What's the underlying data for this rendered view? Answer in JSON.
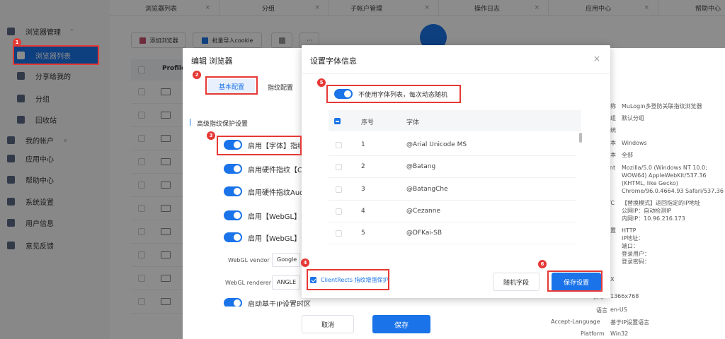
{
  "sidebar": {
    "items": [
      {
        "label": "浏览器管理"
      },
      {
        "label": "浏览器列表"
      },
      {
        "label": "分享给我的"
      },
      {
        "label": "分组"
      },
      {
        "label": "回收站"
      },
      {
        "label": "我的帐户"
      },
      {
        "label": "应用中心"
      },
      {
        "label": "帮助中心"
      },
      {
        "label": "系统设置"
      },
      {
        "label": "用户信息"
      },
      {
        "label": "意见反馈"
      }
    ]
  },
  "tabs": [
    {
      "label": "浏览器列表"
    },
    {
      "label": "分组"
    },
    {
      "label": "子帐户管理"
    },
    {
      "label": "操作日志"
    },
    {
      "label": "应用中心"
    },
    {
      "label": "帮助中心"
    }
  ],
  "toolbar": {
    "add_browser": "添加浏览器",
    "batch_import": "批量导入cookie",
    "more": "···",
    "col_profile": "Profilel"
  },
  "edit_panel": {
    "title": "编辑 浏览器",
    "tab_basic": "基本配置",
    "tab_fingerprint": "指纹配置",
    "section": "高级指纹保护设置",
    "switches": [
      "启用【字体】指纹",
      "启用硬件指纹【Ca",
      "启用硬件指纹Aud",
      "启用【WebGL】图",
      "启用【WebGL】元",
      "启动基于IP设置时区"
    ],
    "webgl_vendor_label": "WebGL vendor",
    "webgl_vendor_value": "Google",
    "webgl_renderer_label": "WebGL renderer",
    "webgl_renderer_value": "ANGLE",
    "cancel": "取消",
    "save": "保存"
  },
  "info": {
    "lines": [
      {
        "k": "称",
        "v": "MuLogin多登防关联指纹浏览器"
      },
      {
        "k": "组",
        "v": "默认分组"
      },
      {
        "k": "",
        "v": "统"
      },
      {
        "k": "本",
        "v": "Windows"
      },
      {
        "k": "本",
        "v": "全部"
      },
      {
        "k": "ent",
        "v": "Mozilla/5.0 (Windows NT 10.0;"
      },
      {
        "k": "",
        "v": "WOW64) AppleWebKit/537.36"
      },
      {
        "k": "",
        "v": "(KHTML, like Gecko)"
      },
      {
        "k": "",
        "v": "Chrome/96.0.4664.93 Safari/537.36"
      },
      {
        "k": "TC",
        "v": "【替换模式】返回指定的IP地址"
      },
      {
        "k": "",
        "v": "公网IP：自动检测IP"
      },
      {
        "k": "",
        "v": "内网IP：10.96.216.173"
      },
      {
        "k": "置",
        "v": "HTTP"
      },
      {
        "k": "",
        "v": "IP地址："
      },
      {
        "k": "",
        "v": "端口："
      },
      {
        "k": "",
        "v": "登录用户："
      },
      {
        "k": "",
        "v": "登录密码："
      },
      {
        "k": "",
        "v": "X"
      }
    ],
    "resolution_label": "辨率",
    "resolution": "1366x768",
    "lang_label": "语言",
    "lang": "en-US",
    "accept_label": "Accept-Language",
    "accept": "基于IP设置语言",
    "platform_label": "Platform",
    "platform": "Win32"
  },
  "modal": {
    "title": "设置字体信息",
    "toggle_label": "不使用字体列表，每次动态随机",
    "col_num": "序号",
    "col_font": "字体",
    "rows": [
      {
        "num": "1",
        "font": "@Arial Unicode MS"
      },
      {
        "num": "2",
        "font": "@Batang"
      },
      {
        "num": "3",
        "font": "@BatangChe"
      },
      {
        "num": "4",
        "font": "@Cezanne"
      },
      {
        "num": "5",
        "font": "@DFKai-SB"
      }
    ],
    "clientrects_label": "ClientRects 指纹增强保护",
    "random_btn": "随机字段",
    "save_btn": "保存设置"
  },
  "badges": [
    "1",
    "2",
    "3",
    "4",
    "5",
    "6"
  ],
  "colors": {
    "accent": "#1a73e8",
    "highlight": "#e53935"
  }
}
